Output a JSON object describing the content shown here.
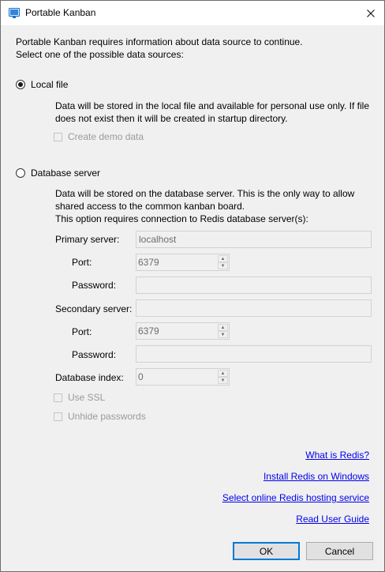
{
  "window": {
    "title": "Portable Kanban"
  },
  "intro": {
    "line1": "Portable Kanban requires information about data source to continue.",
    "line2": "Select one of the possible data sources:"
  },
  "local_file": {
    "label": "Local file",
    "selected": true,
    "desc_line1": "Data will be stored in the local file and available for personal use only. If file",
    "desc_line2": "does not exist then it will be created in startup directory.",
    "demo_label": "Create demo data"
  },
  "database": {
    "label": "Database server",
    "selected": false,
    "desc_line1": "Data will be stored on the database server. This is the only way to allow",
    "desc_line2": "shared access to the common kanban board.",
    "desc_line3": "This option requires connection to Redis database server(s):",
    "primary_label": "Primary server:",
    "primary_value": "localhost",
    "primary_port_label": "Port:",
    "primary_port_value": "6379",
    "primary_password_label": "Password:",
    "primary_password_value": "",
    "secondary_label": "Secondary server:",
    "secondary_value": "",
    "secondary_port_label": "Port:",
    "secondary_port_value": "6379",
    "secondary_password_label": "Password:",
    "secondary_password_value": "",
    "index_label": "Database index:",
    "index_value": "0",
    "ssl_label": "Use SSL",
    "unhide_label": "Unhide passwords"
  },
  "links": {
    "what_is_redis": "What is Redis?",
    "install_redis": "Install Redis on Windows",
    "hosting": "Select online Redis hosting service",
    "guide": "Read User Guide"
  },
  "buttons": {
    "ok": "OK",
    "cancel": "Cancel"
  },
  "colors": {
    "link": "#0000ee",
    "accent": "#0078d7",
    "disabled_text": "#9a9a9a"
  }
}
